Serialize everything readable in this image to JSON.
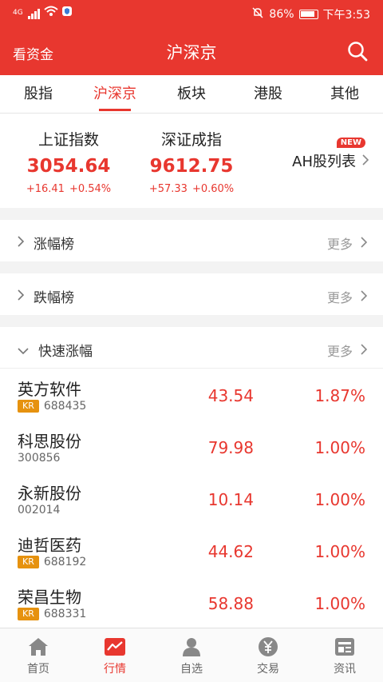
{
  "status_bar": {
    "network": "4G",
    "battery": "86%",
    "time": "下午3:53"
  },
  "header": {
    "left_link": "看资金",
    "title": "沪深京"
  },
  "tabs": [
    {
      "label": "股指",
      "active": false
    },
    {
      "label": "沪深京",
      "active": true
    },
    {
      "label": "板块",
      "active": false
    },
    {
      "label": "港股",
      "active": false
    },
    {
      "label": "其他",
      "active": false
    }
  ],
  "indices": [
    {
      "name": "上证指数",
      "value": "3054.64",
      "change": "+16.41",
      "change_pct": "+0.54%"
    },
    {
      "name": "深证成指",
      "value": "9612.75",
      "change": "+57.33",
      "change_pct": "+0.60%"
    }
  ],
  "ah_link": {
    "label": "AH股列表",
    "badge": "NEW"
  },
  "sections": {
    "rise": {
      "label": "涨幅榜",
      "more": "更多"
    },
    "fall": {
      "label": "跌幅榜",
      "more": "更多"
    },
    "fast": {
      "label": "快速涨幅",
      "more": "更多"
    }
  },
  "stocks": [
    {
      "name": "英方软件",
      "tag": "KR",
      "code": "688435",
      "price": "43.54",
      "pct": "1.87%"
    },
    {
      "name": "科思股份",
      "tag": "",
      "code": "300856",
      "price": "79.98",
      "pct": "1.00%"
    },
    {
      "name": "永新股份",
      "tag": "",
      "code": "002014",
      "price": "10.14",
      "pct": "1.00%"
    },
    {
      "name": "迪哲医药",
      "tag": "KR",
      "code": "688192",
      "price": "44.62",
      "pct": "1.00%"
    },
    {
      "name": "荣昌生物",
      "tag": "KR",
      "code": "688331",
      "price": "58.88",
      "pct": "1.00%"
    }
  ],
  "bottom_nav": [
    {
      "label": "首页",
      "icon": "home-icon",
      "active": false
    },
    {
      "label": "行情",
      "icon": "market-chart-icon",
      "active": true
    },
    {
      "label": "自选",
      "icon": "user-icon",
      "active": false
    },
    {
      "label": "交易",
      "icon": "yuan-coin-icon",
      "active": false
    },
    {
      "label": "资讯",
      "icon": "news-icon",
      "active": false
    }
  ],
  "colors": {
    "brand_red": "#e8372f",
    "tag_orange": "#e6920f"
  }
}
